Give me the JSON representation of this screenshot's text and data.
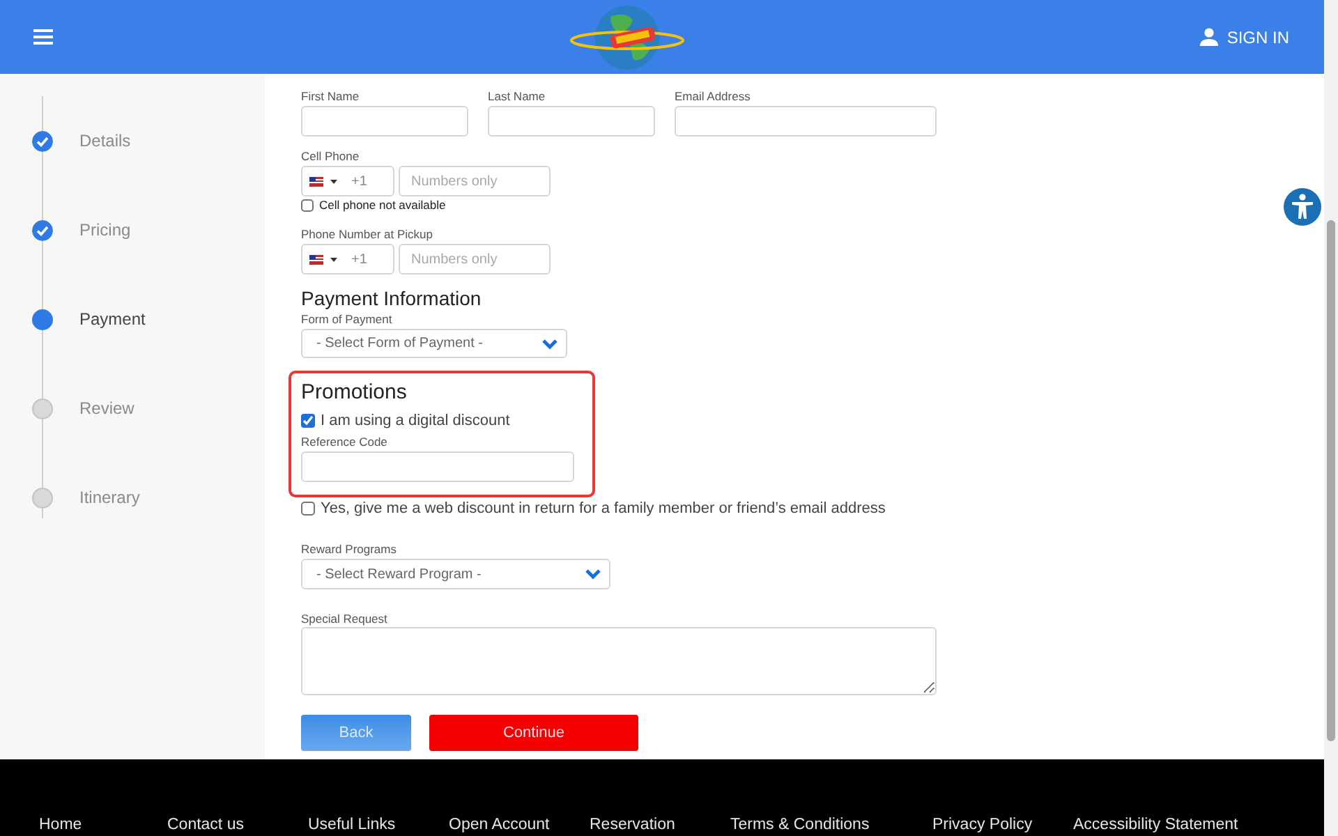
{
  "header": {
    "sign_in": "SIGN IN"
  },
  "steps": [
    {
      "label": "Details",
      "completed": true,
      "selected": false
    },
    {
      "label": "Pricing",
      "completed": true,
      "selected": false
    },
    {
      "label": "Payment",
      "completed": false,
      "selected": true
    },
    {
      "label": "Review",
      "completed": false,
      "selected": false
    },
    {
      "label": "Itinerary",
      "completed": false,
      "selected": false
    }
  ],
  "passenger": {
    "fields": [
      {
        "label": "First Name"
      },
      {
        "label": "Last Name"
      },
      {
        "label": "Email Address"
      }
    ],
    "cell_phone": {
      "label": "Cell Phone",
      "code": "+1",
      "placeholder": "Numbers only"
    },
    "cell_unavailable": {
      "label": "Cell phone not available",
      "checked": false
    },
    "pickup_phone": {
      "label": "Phone Number at Pickup",
      "code": "+1",
      "placeholder": "Numbers only"
    }
  },
  "payment": {
    "heading": "Payment Information",
    "label": "Form of Payment",
    "value": "- Select Form of Payment -"
  },
  "promotions": {
    "heading": "Promotions",
    "digital_discount": {
      "label": "I am using a digital discount",
      "checked": true
    },
    "reference_code": {
      "label": "Reference Code"
    }
  },
  "web_discount": {
    "label": "Yes, give me a web discount in return for a family member or friend’s email address",
    "checked": false
  },
  "rewards": {
    "label": "Reward Programs",
    "value": "- Select Reward Program -"
  },
  "special_request": {
    "label": "Special Request"
  },
  "buttons": [
    {
      "label": "Back",
      "kind": "secondary"
    },
    {
      "label": "Continue",
      "kind": "primary"
    }
  ],
  "footer": {
    "links": [
      "Home",
      "Contact us",
      "Useful Links",
      "Open Account",
      "Reservation",
      "Terms & Conditions",
      "Privacy Policy",
      "Accessibility Statement"
    ]
  }
}
